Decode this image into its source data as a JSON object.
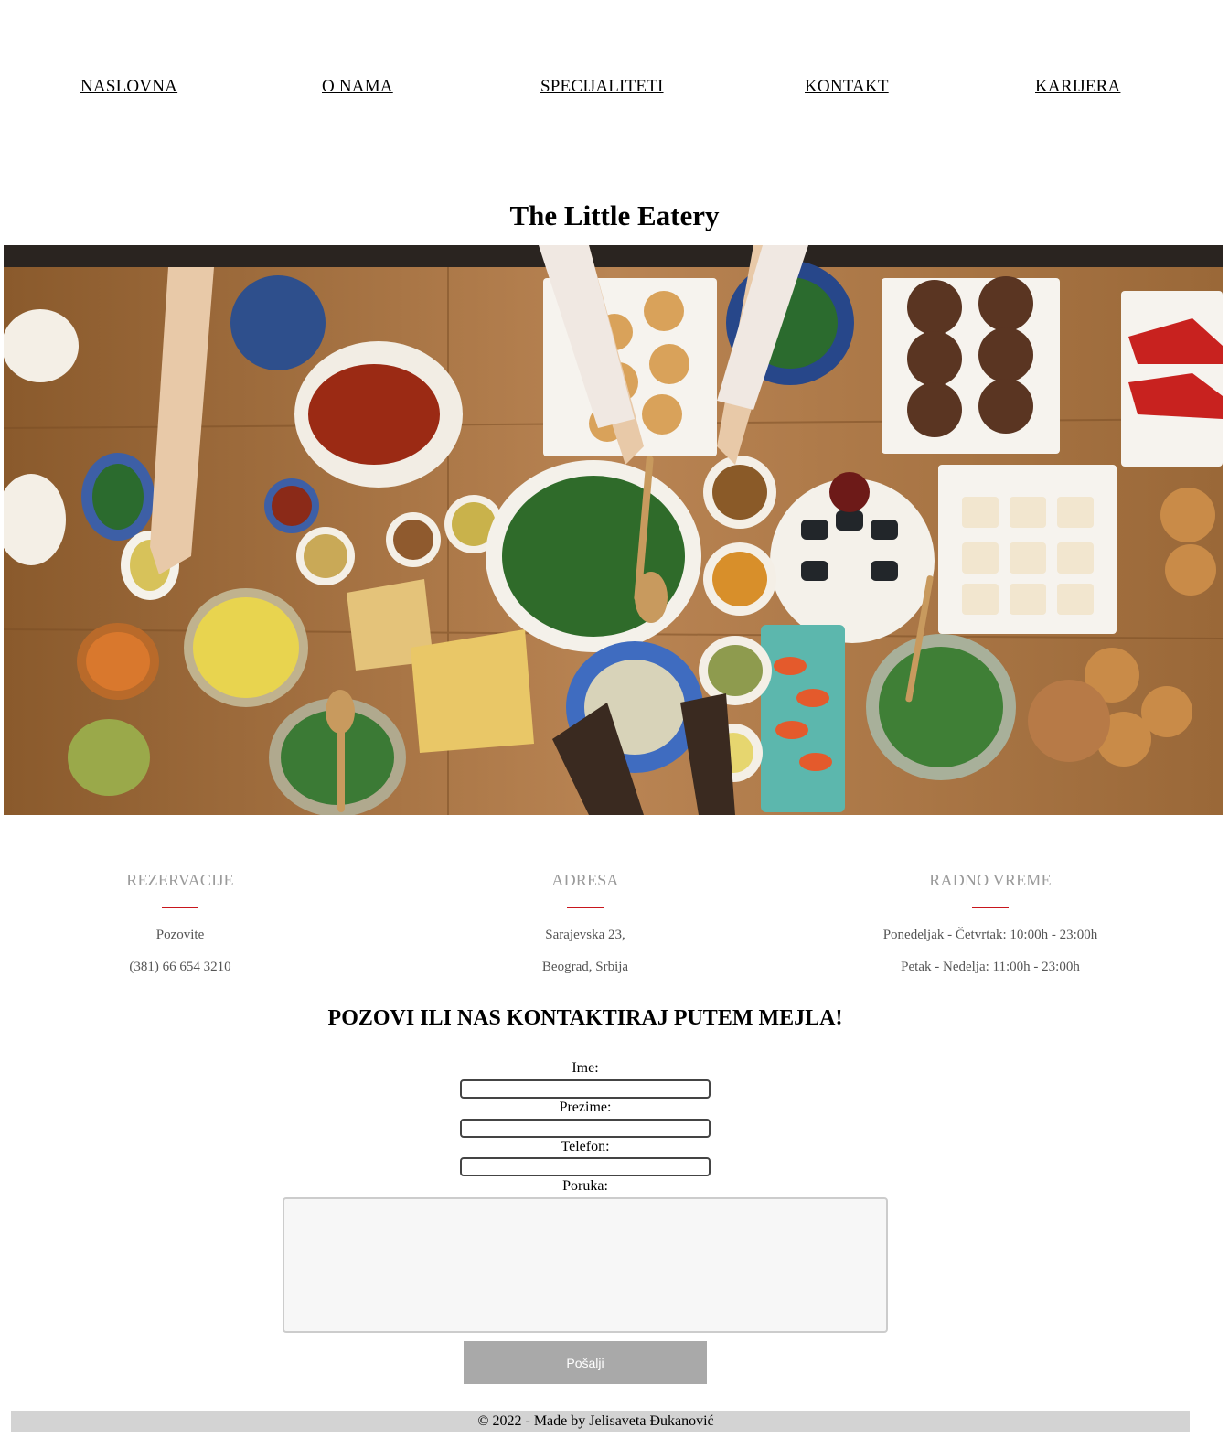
{
  "nav": {
    "items": [
      {
        "label": "NASLOVNA"
      },
      {
        "label": "O NAMA"
      },
      {
        "label": "SPECIJALITETI"
      },
      {
        "label": "KONTAKT"
      },
      {
        "label": "KARIJERA"
      }
    ]
  },
  "site_title": "The Little Eatery",
  "info": [
    {
      "heading": "REZERVACIJE",
      "line1": "Pozovite",
      "line2": "(381) 66 654 3210"
    },
    {
      "heading": "ADRESA",
      "line1": "Sarajevska 23,",
      "line2": "Beograd, Srbija"
    },
    {
      "heading": "RADNO VREME",
      "line1": "Ponedeljak - Četvrtak: 10:00h - 23:00h",
      "line2": "Petak - Nedelja: 11:00h - 23:00h"
    }
  ],
  "contact": {
    "heading": "POZOVI ILI NAS KONTAKTIRAJ PUTEM MEJLA!",
    "fields": {
      "first_name": {
        "label": "Ime:",
        "value": ""
      },
      "last_name": {
        "label": "Prezime:",
        "value": ""
      },
      "phone": {
        "label": "Telefon:",
        "value": ""
      },
      "message": {
        "label": "Poruka:",
        "value": ""
      }
    },
    "submit_label": "Pošalji"
  },
  "footer": {
    "text": "© 2022 - Made by Jelisaveta Đukanović"
  },
  "colors": {
    "accent_rule": "#c8161d",
    "button": "#a9a9a9",
    "footer_bg": "#d3d3d3"
  }
}
